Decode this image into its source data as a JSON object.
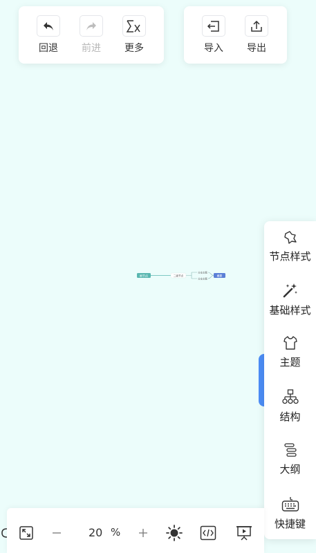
{
  "toolbar_left": {
    "undo_label": "回退",
    "redo_label": "前进",
    "more_label": "更多"
  },
  "toolbar_right": {
    "import_label": "导入",
    "export_label": "导出"
  },
  "mindmap": {
    "root": "根节点",
    "branch": "二级节点",
    "sub1": "分支主题",
    "sub2": "分支主题",
    "tail": "概要"
  },
  "sidebar": {
    "items": [
      {
        "label": "节点样式",
        "icon": "node-style-icon"
      },
      {
        "label": "基础样式",
        "icon": "magic-wand-icon"
      },
      {
        "label": "主题",
        "icon": "shirt-icon"
      },
      {
        "label": "结构",
        "icon": "structure-icon"
      },
      {
        "label": "大纲",
        "icon": "outline-icon"
      },
      {
        "label": "快捷键",
        "icon": "keyboard-icon"
      }
    ]
  },
  "bottombar": {
    "zoom_value": "20",
    "zoom_unit": "%"
  },
  "colors": {
    "background": "#ecfdfb",
    "accent_blue": "#4c8df6",
    "root_node": "#5ab7b0",
    "tail_node": "#5b7fd6"
  }
}
